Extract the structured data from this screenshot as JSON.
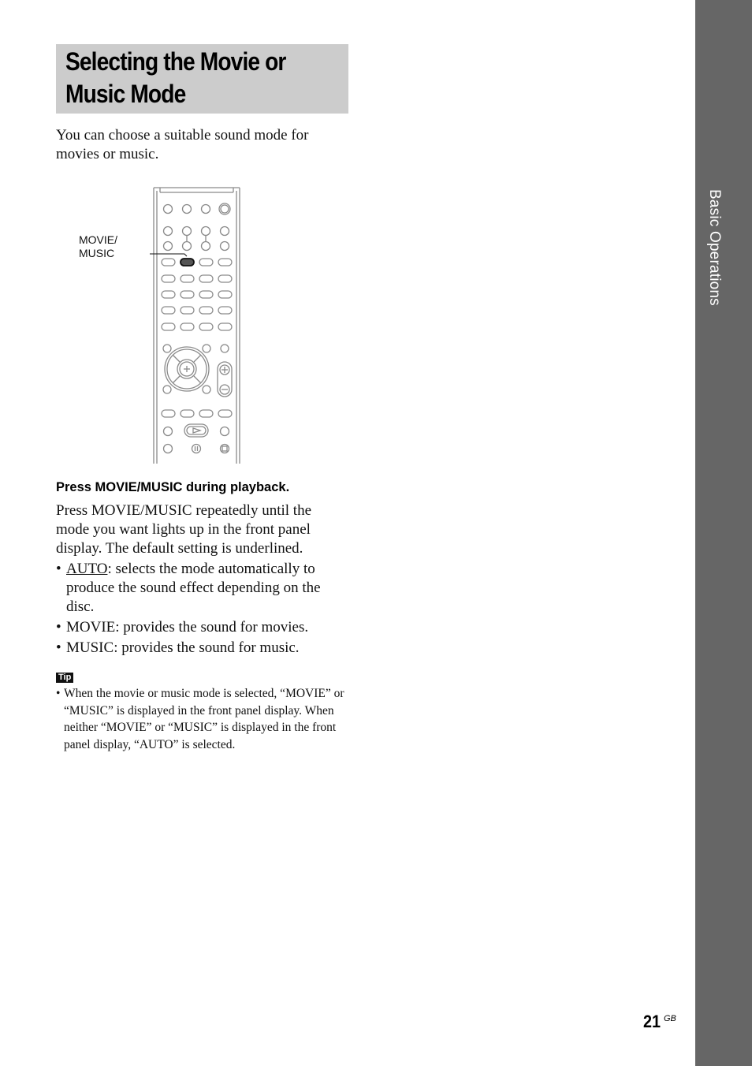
{
  "section_tab": "Basic Operations",
  "heading": {
    "line1": "Selecting the Movie or",
    "line2": "Music Mode"
  },
  "intro": "You can choose a suitable sound mode for movies or music.",
  "figure": {
    "callout_label_line1": "MOVIE/",
    "callout_label_line2": "MUSIC",
    "icon": "remote-control-illustration"
  },
  "step": {
    "heading": "Press MOVIE/MUSIC during playback.",
    "body": "Press MOVIE/MUSIC repeatedly until the mode you want lights up in the front panel display. The default setting is underlined.",
    "options": [
      {
        "name": "AUTO",
        "desc": ": selects the mode automatically to produce the sound effect depending on the disc.",
        "default": true
      },
      {
        "name": "MOVIE",
        "desc": ": provides the sound for movies.",
        "default": false
      },
      {
        "name": "MUSIC",
        "desc": ": provides the sound for music.",
        "default": false
      }
    ]
  },
  "tip": {
    "label": "Tip",
    "text": "When the movie or music mode is selected, “MOVIE” or “MUSIC” is displayed in the front panel display. When neither “MOVIE” or “MUSIC” is displayed in the front panel display, “AUTO” is selected."
  },
  "footer": {
    "page_number": "21",
    "page_suffix": "GB"
  }
}
